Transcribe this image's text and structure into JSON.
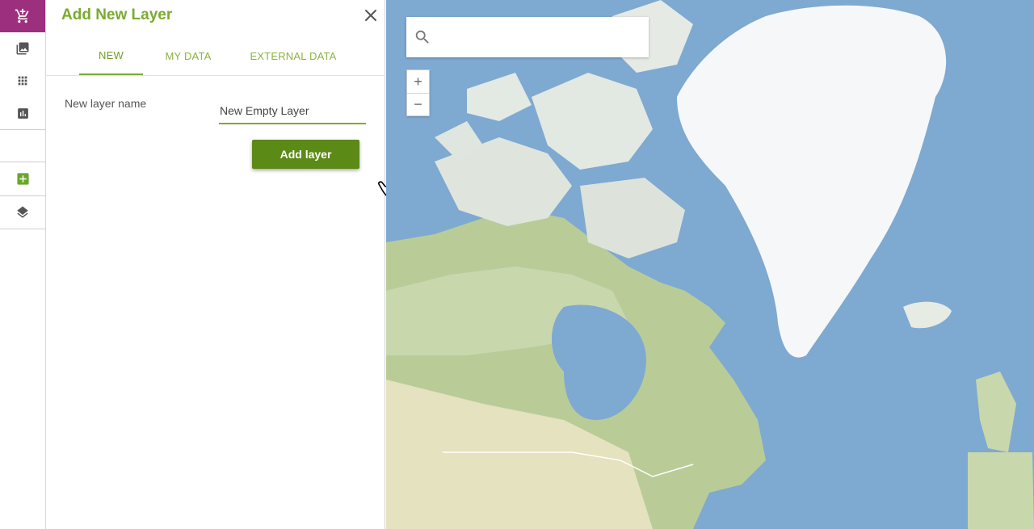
{
  "rail": {
    "items": [
      {
        "icon": "cart-add-icon"
      },
      {
        "icon": "gallery-icon"
      },
      {
        "icon": "apps-grid-icon"
      },
      {
        "icon": "bar-chart-icon"
      },
      {
        "icon": "add-square-icon"
      },
      {
        "icon": "layers-icon"
      }
    ],
    "accent": "#9c2f7e",
    "green": "#7aab2f"
  },
  "panel": {
    "title": "Add New Layer",
    "tabs": [
      {
        "label": "NEW",
        "active": true
      },
      {
        "label": "MY DATA",
        "active": false
      },
      {
        "label": "EXTERNAL DATA",
        "active": false
      }
    ],
    "field_label": "New layer name",
    "field_value": "New Empty Layer",
    "add_button_label": "Add layer",
    "button_color": "#5c8a17"
  },
  "map": {
    "search_placeholder": "",
    "zoom_in_label": "+",
    "zoom_out_label": "−"
  }
}
